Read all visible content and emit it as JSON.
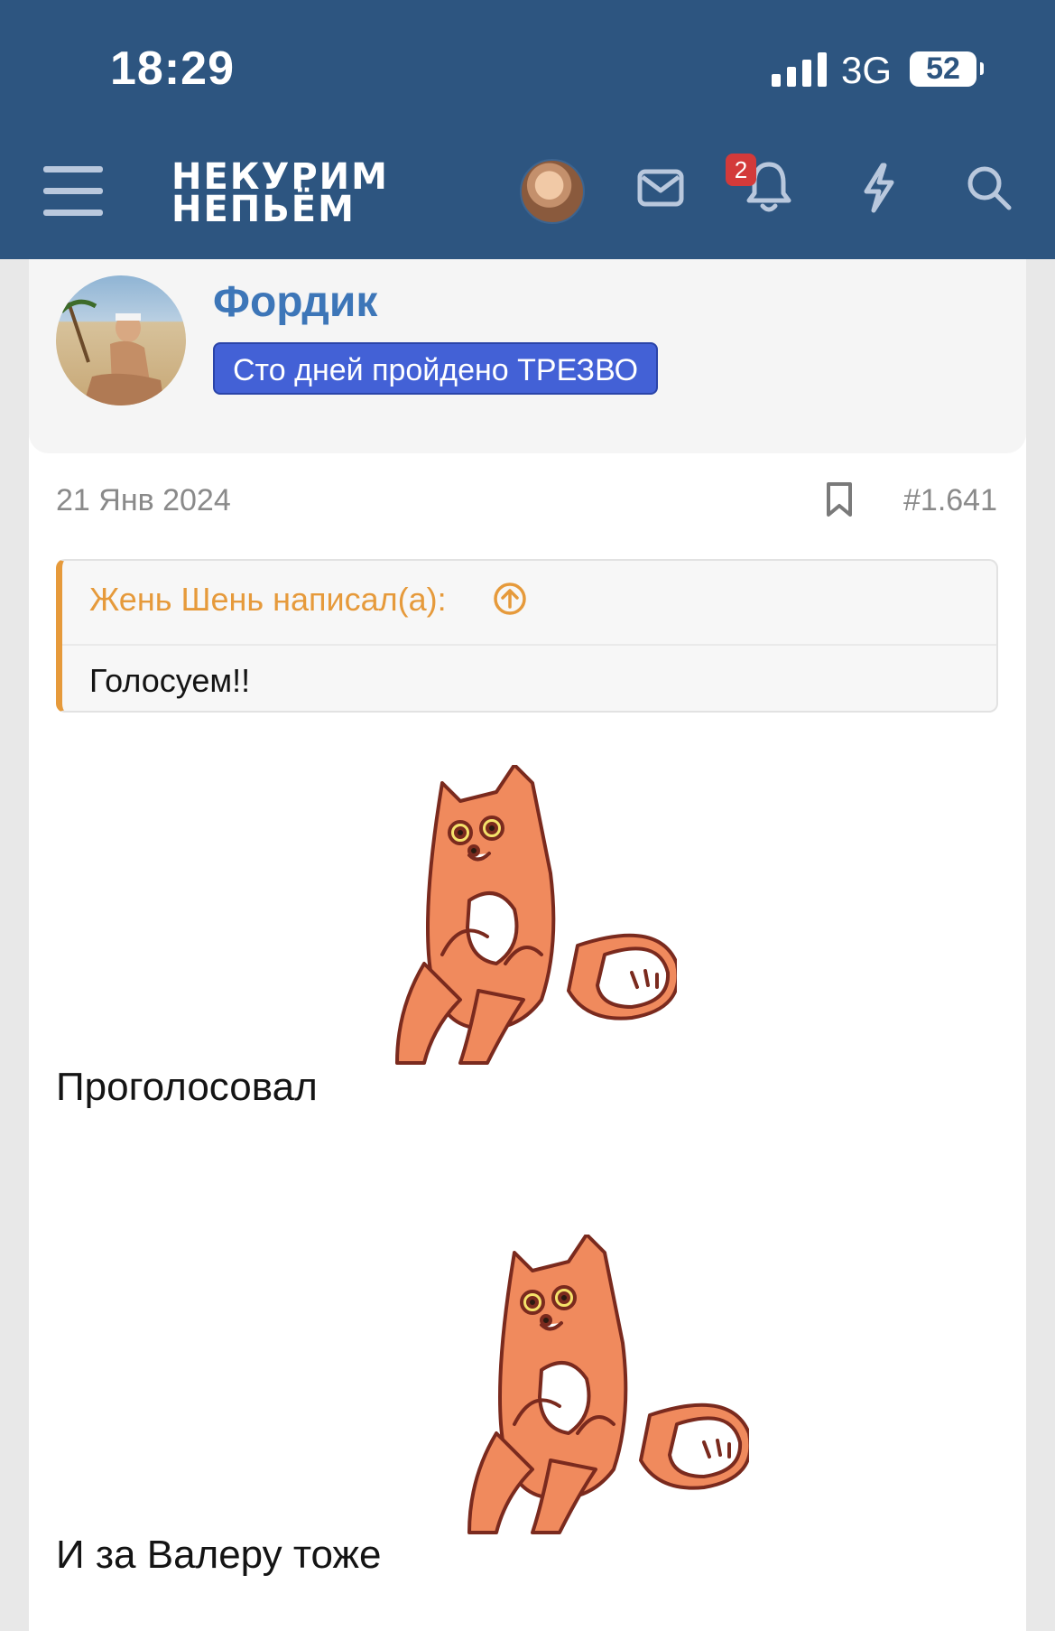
{
  "status_bar": {
    "time": "18:29",
    "network": "3G",
    "battery": "52"
  },
  "header": {
    "logo_line1": "НЕКУРИМ",
    "logo_line2": "НЕПЬЁМ",
    "notification_count": "2",
    "icons": [
      "menu-icon",
      "avatar",
      "mail-icon",
      "bell-icon",
      "lightning-icon",
      "search-icon"
    ],
    "color": "#2d5580"
  },
  "post": {
    "author": "Фордик",
    "author_title": "Сто дней пройдено ТРЕЗВО",
    "date": "21 Янв 2024",
    "number": "#1.641",
    "quote": {
      "header": "Жень Шень написал(а):",
      "body": "Голосуем!!"
    },
    "lines": [
      {
        "text": "Проголосовал",
        "sticker": "orange-fox-sticker"
      },
      {
        "text": "И за Валеру тоже",
        "sticker": "orange-fox-sticker"
      }
    ]
  },
  "colors": {
    "accent_blue": "#3d76b8",
    "badge_blue": "#4361d6",
    "quote_orange": "#e69a3b",
    "notification_red": "#d33a3a"
  }
}
